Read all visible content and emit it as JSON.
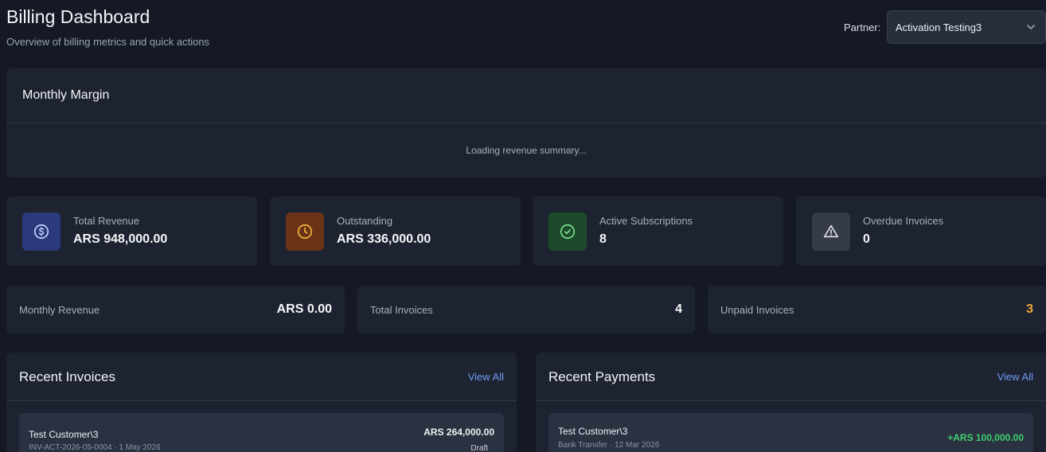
{
  "header": {
    "title": "Billing Dashboard",
    "subtitle": "Overview of billing metrics and quick actions",
    "partner_label": "Partner:",
    "partner_value": "Activation Testing3"
  },
  "margin": {
    "title": "Monthly Margin",
    "loading_text": "Loading revenue summary..."
  },
  "stats": [
    {
      "label": "Total Revenue",
      "value": "ARS 948,000.00",
      "icon": "dollar-icon",
      "color": "#2a3a7a"
    },
    {
      "label": "Outstanding",
      "value": "ARS 336,000.00",
      "icon": "clock-icon",
      "color": "#6b3418"
    },
    {
      "label": "Active Subscriptions",
      "value": "8",
      "icon": "check-circle-icon",
      "color": "#1c4a2a"
    },
    {
      "label": "Overdue Invoices",
      "value": "0",
      "icon": "warning-icon",
      "color": "#353b48"
    }
  ],
  "mini": [
    {
      "label": "Monthly Revenue",
      "value": "ARS 0.00"
    },
    {
      "label": "Total Invoices",
      "value": "4"
    },
    {
      "label": "Unpaid Invoices",
      "value": "3",
      "color": "#f0a83a"
    }
  ],
  "invoices": {
    "title": "Recent Invoices",
    "view_all": "View All",
    "items": [
      {
        "customer": "Test Customer\\3",
        "meta": "INV-ACT-2026-05-0004 · 1 May 2026",
        "amount": "ARS 264,000.00",
        "status": "Draft"
      }
    ]
  },
  "payments": {
    "title": "Recent Payments",
    "view_all": "View All",
    "items": [
      {
        "customer": "Test Customer\\3",
        "meta": "Bank Transfer · 12 Mar 2026",
        "amount": "+ARS 100,000.00"
      }
    ]
  }
}
